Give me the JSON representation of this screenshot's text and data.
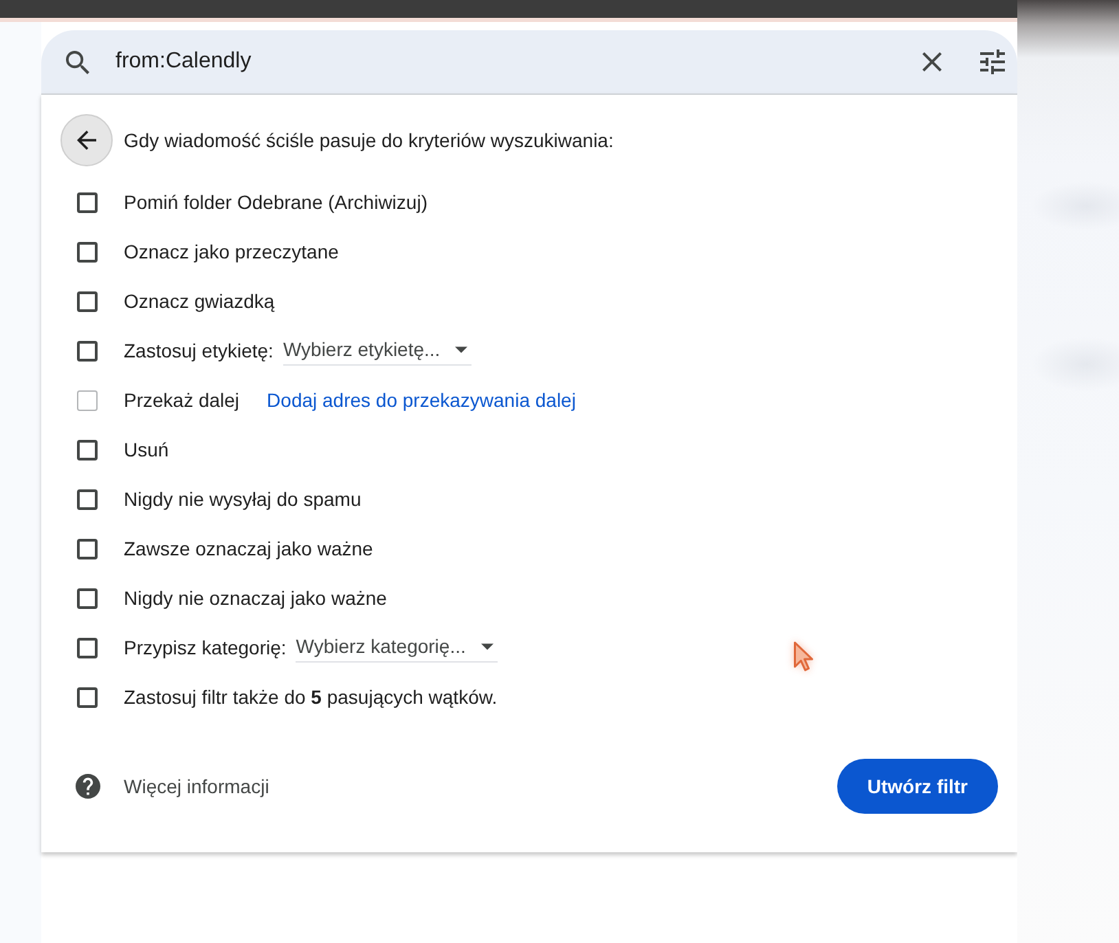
{
  "search": {
    "value": "from:Calendly"
  },
  "filter_panel": {
    "heading": "Gdy wiadomość ściśle pasuje do kryteriów wyszukiwania:",
    "options": [
      {
        "kind": "plain",
        "label": "Pomiń folder Odebrane (Archiwizuj)",
        "checked": false,
        "disabled": false
      },
      {
        "kind": "plain",
        "label": "Oznacz jako przeczytane",
        "checked": false,
        "disabled": false
      },
      {
        "kind": "plain",
        "label": "Oznacz gwiazdką",
        "checked": false,
        "disabled": false
      },
      {
        "kind": "select",
        "label": "Zastosuj etykietę:",
        "select": "Wybierz etykietę...",
        "checked": false,
        "disabled": false
      },
      {
        "kind": "link",
        "label": "Przekaż dalej",
        "link": "Dodaj adres do przekazywania dalej",
        "checked": false,
        "disabled": true
      },
      {
        "kind": "plain",
        "label": "Usuń",
        "checked": false,
        "disabled": false
      },
      {
        "kind": "plain",
        "label": "Nigdy nie wysyłaj do spamu",
        "checked": false,
        "disabled": false
      },
      {
        "kind": "plain",
        "label": "Zawsze oznaczaj jako ważne",
        "checked": false,
        "disabled": false
      },
      {
        "kind": "plain",
        "label": "Nigdy nie oznaczaj jako ważne",
        "checked": false,
        "disabled": false
      },
      {
        "kind": "select",
        "label": "Przypisz kategorię:",
        "select": "Wybierz kategorię...",
        "checked": false,
        "disabled": false
      },
      {
        "kind": "plain",
        "label": "Zastosuj filtr także do **5** pasujących wątków.",
        "checked": false,
        "disabled": false
      }
    ],
    "help_link": "Więcej informacji",
    "create_button": "Utwórz filtr"
  }
}
